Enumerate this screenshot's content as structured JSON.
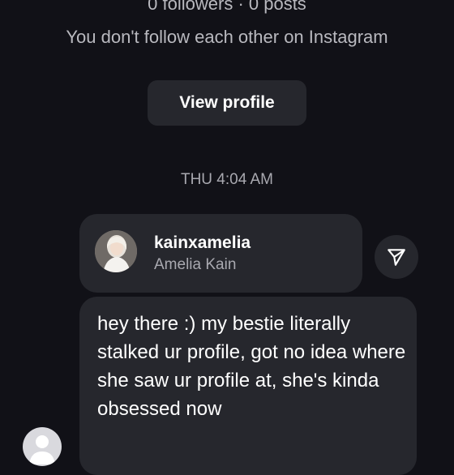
{
  "profile_summary": {
    "stats": "0 followers · 0 posts",
    "mutual_status": "You don't follow each other on Instagram",
    "view_profile_label": "View profile"
  },
  "thread": {
    "timestamp": "THU 4:04 AM",
    "shared_profile": {
      "username": "kainxamelia",
      "full_name": "Amelia Kain",
      "share_icon": "send-icon"
    },
    "message": {
      "text": "hey there :) my bestie literally stalked ur profile, got no idea where she saw ur profile at, she's kinda obsessed now"
    },
    "sender_avatar_icon": "default-avatar-icon"
  },
  "colors": {
    "background": "#111117",
    "bubble": "#26272d",
    "secondary_text": "#a9a9b0"
  }
}
